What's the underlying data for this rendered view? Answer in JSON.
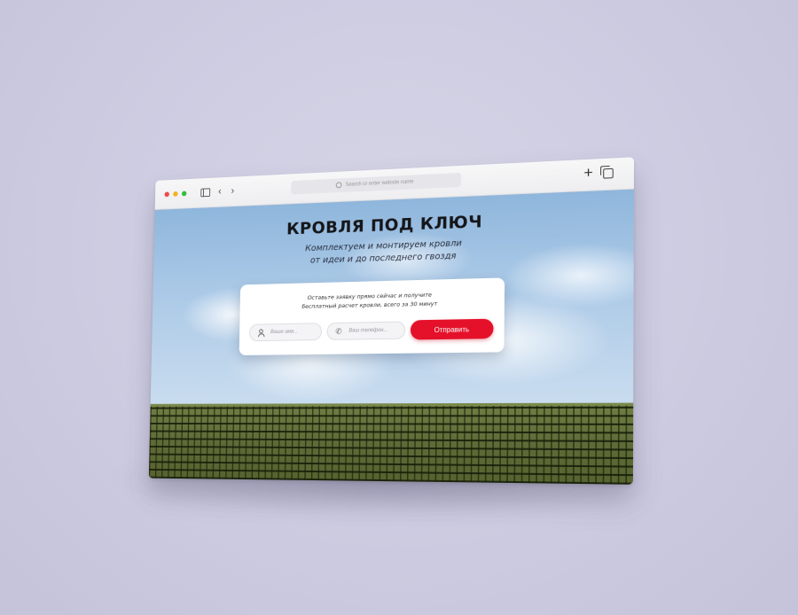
{
  "browser": {
    "address_placeholder": "Search or enter website name",
    "nav_back": "‹",
    "nav_forward": "›",
    "new_tab": "+"
  },
  "hero": {
    "title": "КРОВЛЯ ПОД КЛЮЧ",
    "subtitle_line1": "Комплектуем и монтируем кровли",
    "subtitle_line2": "от идеи и до последнего гвоздя"
  },
  "form": {
    "text_line1": "Оставьте заявку прямо сейчас и получите",
    "text_line2": "бесплатный расчет кровли, всего за 30 минут",
    "name_placeholder": "Ваше имя...",
    "phone_placeholder": "Ваш телефон...",
    "submit_label": "Отправить"
  },
  "colors": {
    "accent": "#e5112a",
    "roof": "#5d6a36",
    "sky": "#a9c8e6"
  }
}
